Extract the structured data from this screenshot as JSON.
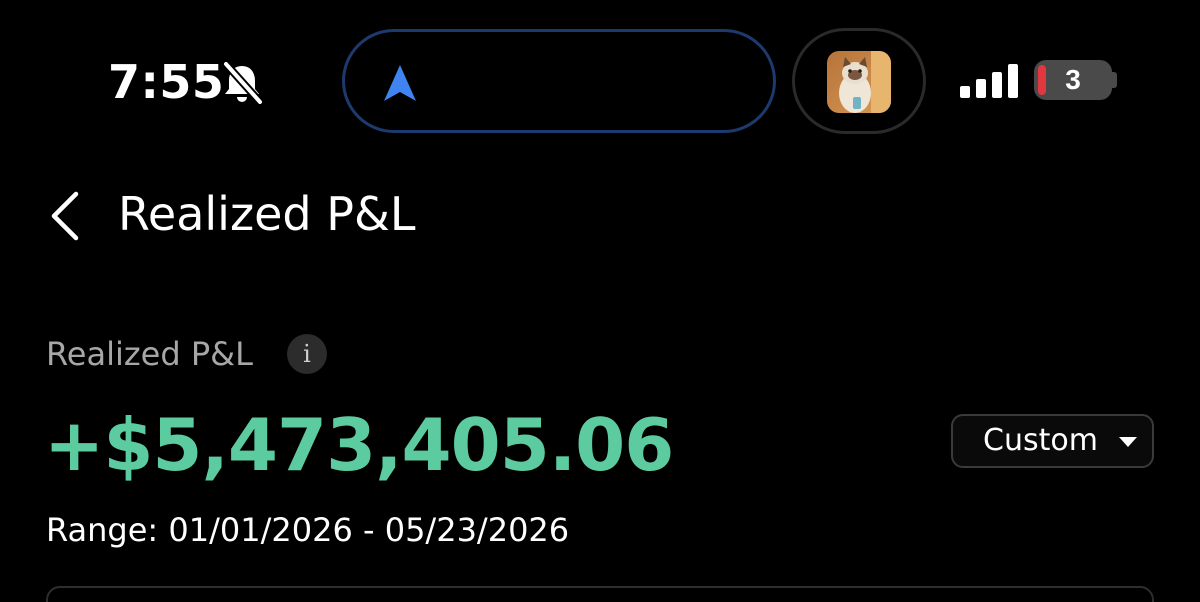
{
  "status_bar": {
    "time": "7:55",
    "silent_icon": "bell-slash-icon",
    "navigation_icon": "navigation-arrow-icon",
    "signal_icon": "cellular-signal-icon",
    "battery_level": "3",
    "battery_icon": "battery-icon",
    "colors": {
      "island_border": "#1d3a6e",
      "nav_arrow": "#3f84f0",
      "battery_low": "#e0383e"
    }
  },
  "header": {
    "back_icon": "chevron-left-icon",
    "title": "Realized P&L"
  },
  "summary": {
    "label": "Realized P&L",
    "info_icon_glyph": "i",
    "value": "+$5,473,405.06",
    "value_color": "#5ccca0",
    "range_filter": {
      "selected": "Custom",
      "icon": "caret-down-icon"
    },
    "range_text": "Range: 01/01/2026 - 05/23/2026"
  }
}
